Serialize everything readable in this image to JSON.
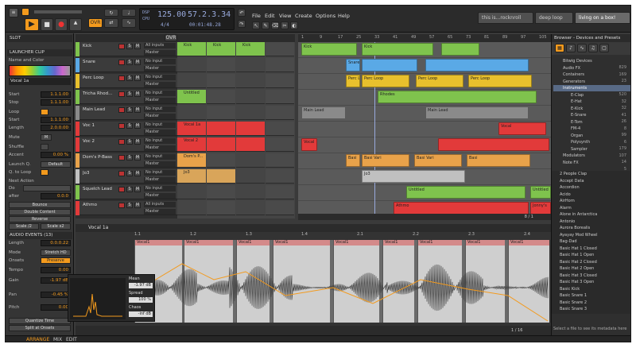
{
  "topbar": {
    "tempo": "125.00",
    "signature": "4/4",
    "position": "57.2.3.34",
    "time": "00:01:48.28",
    "buttons": {
      "ovr": "OVR",
      "dsp": "DSP",
      "cpu": "CPU"
    },
    "menus": [
      "File",
      "Edit",
      "View",
      "Create",
      "Options",
      "Help"
    ],
    "tabs": [
      "this is...rocknroll",
      "deep loop",
      "living on a box!"
    ]
  },
  "inspector": {
    "slot": "SLOT",
    "launcher": "LAUNCHER CLIP",
    "name_color": "Name and Color",
    "clip_name": "Vocal 1a",
    "start_label": "Start",
    "start": "1.1.1.00",
    "stop_label": "Stop",
    "stop": "1.1.1.00",
    "loop_label": "Loop",
    "loop_start": "1.1.1.00",
    "loop_length": "2.0.0.00",
    "start2": "Start",
    "length": "Length",
    "mute": "Mute",
    "m": "M",
    "shuffle": "Shuffle",
    "accent": "Accent",
    "accent_val": "0.00 %",
    "launch_q": "Launch Q.",
    "launch_q_val": "Default",
    "q_to_loop": "Q. to Loop",
    "next_action": "Next Action",
    "do": "Do",
    "after": "after",
    "after_val": "0.0.0",
    "bounce": "Bounce",
    "double": "Double Content",
    "reverse": "Reverse",
    "scale2": "Scale /2",
    "scalex2": "Scale x2",
    "audio_events": "AUDIO EVENTS (13)",
    "ae_length": "Length",
    "ae_length_val": "0.0.0.22",
    "mode": "Mode",
    "mode_val": "Stretch HD",
    "onsets": "Onsets",
    "onsets_val": "Preserve",
    "tempo": "Tempo",
    "tempo_val": "0.00",
    "gain": "Gain",
    "gain_val": "-1.97 dB",
    "pan": "Pan",
    "pan_val": "-0.45 %",
    "pitch": "Pitch",
    "pitch_val": "0.00",
    "mean": "Mean",
    "mean_val": "-1.97 dB",
    "spread": "Spread",
    "spread_val": "100 %",
    "chaos": "Chaos",
    "chaos_val": "-inf dB",
    "quantize": "Quantize Time",
    "split": "Split at Onsets"
  },
  "tracks": [
    {
      "name": "Kick",
      "color": "#7fc34d",
      "in": "All inputs",
      "out": "Master"
    },
    {
      "name": "Snare",
      "color": "#5aa9e6",
      "in": "No input",
      "out": "Master"
    },
    {
      "name": "Perc Loop",
      "color": "#e8c02d",
      "in": "No input",
      "out": "Master"
    },
    {
      "name": "Tricha Rhod...",
      "color": "#7fc34d",
      "in": "No input",
      "out": "Master"
    },
    {
      "name": "Main Lead",
      "color": "#8a8a8a",
      "in": "No input",
      "out": "Master"
    },
    {
      "name": "Voc 1",
      "color": "#e23a3a",
      "in": "No input",
      "out": "Master"
    },
    {
      "name": "Voc 2",
      "color": "#e23a3a",
      "in": "No input",
      "out": "Master"
    },
    {
      "name": "Dom's P-Bass",
      "color": "#e8a24a",
      "in": "No input",
      "out": "Master"
    },
    {
      "name": "Jo3",
      "color": "#c0c0c0",
      "in": "No input",
      "out": "Master"
    },
    {
      "name": "Squelch Lead",
      "color": "#7fc34d",
      "in": "No input",
      "out": "Master"
    },
    {
      "name": "Athmo",
      "color": "#e23a3a",
      "in": "All inputs",
      "out": "Master"
    }
  ],
  "track_btn": {
    "s": "S",
    "m": "M"
  },
  "launcher_clips": [
    "Kick",
    "Kick",
    "Kick",
    "Untitled",
    "Vocal 1a",
    "Vocal 2",
    "Dom's P...",
    "Jo3"
  ],
  "arranger_clips": [
    "Kick",
    "Kick",
    "Snare",
    "Perc Loop",
    "Perc Loop",
    "Perc Loop",
    "Perc Loop",
    "Rhodes",
    "Main Lead",
    "Main Lead",
    "Vocal",
    "Vocal",
    "Basi",
    "Basi Vari",
    "Basi Vari",
    "Basi",
    "Jo3",
    "Untitled",
    "Untitled",
    "Athmo",
    "Jonny's"
  ],
  "ruler": [
    "1",
    "9",
    "17",
    "25",
    "33",
    "41",
    "49",
    "57",
    "65",
    "73",
    "81",
    "89",
    "97",
    "105"
  ],
  "arranger_status": "8 / 1",
  "editor": {
    "clip": "Vocal 1a",
    "bars": [
      "1.1",
      "1.2",
      "1.3",
      "1.4",
      "2.1",
      "2.2",
      "2.3",
      "2.4"
    ],
    "seg_label": "Vocal1",
    "zoom": "1 / 16"
  },
  "browser": {
    "title": "Browser - Devices and Presets",
    "tree": [
      {
        "n": "Bitwig Devices",
        "c": "829"
      },
      {
        "n": "Audio FX",
        "c": "169"
      },
      {
        "n": "Containers",
        "c": "23"
      },
      {
        "n": "Generators",
        "c": "22"
      },
      {
        "n": "Instruments",
        "c": "520"
      },
      {
        "n": "E-Clap",
        "c": "32"
      },
      {
        "n": "E-Hat",
        "c": "32"
      },
      {
        "n": "E-Kick",
        "c": "41"
      },
      {
        "n": "E-Snare",
        "c": "26"
      },
      {
        "n": "E-Tom",
        "c": "8"
      },
      {
        "n": "FM-4",
        "c": "99"
      },
      {
        "n": "Organ",
        "c": "6"
      },
      {
        "n": "Polysynth",
        "c": "179"
      },
      {
        "n": "Sampler",
        "c": "107"
      },
      {
        "n": "Modulators",
        "c": "14"
      },
      {
        "n": "Note FX",
        "c": "5"
      }
    ],
    "presets": [
      "2 People Clap",
      "Accept Data",
      "Accordion",
      "Acido",
      "AirHorn",
      "Alarm",
      "Alone in Antarctica",
      "Antonio",
      "Aurora Borealis",
      "Ayayay Mod Wheel",
      "Bag-Dad",
      "Basic Hat 1 Closed",
      "Basic Hat 1 Open",
      "Basic Hat 2 Closed",
      "Basic Hat 2 Open",
      "Basic Hat 3 Closed",
      "Basic Hat 3 Open",
      "Basic Kick",
      "Basic Snare 1",
      "Basic Snare 2",
      "Basic Snare 3"
    ],
    "footer": "Select a file to see its metadata here"
  },
  "statusbar": {
    "arrange": "ARRANGE",
    "mix": "MIX",
    "edit": "EDIT"
  }
}
